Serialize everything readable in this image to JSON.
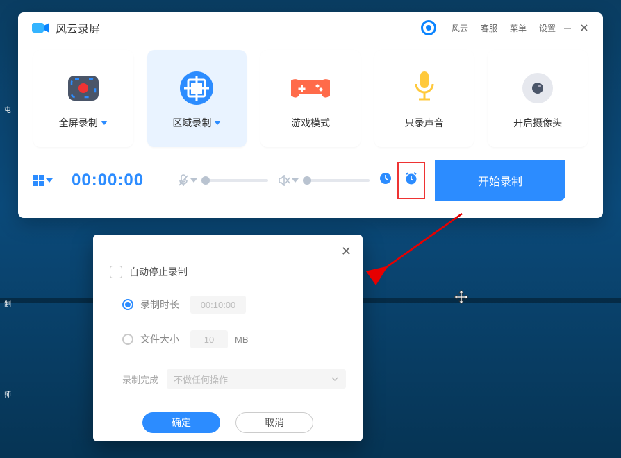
{
  "app": {
    "title": "风云录屏"
  },
  "titlebar": {
    "links": [
      "风云",
      "客服",
      "菜单",
      "设置"
    ]
  },
  "modes": {
    "fullscreen": "全屏录制",
    "region": "区域录制",
    "game": "游戏模式",
    "audio": "只录声音",
    "camera": "开启摄像头"
  },
  "controls": {
    "timer": "00:00:00",
    "start": "开始录制"
  },
  "modal": {
    "autoStop": "自动停止录制",
    "duration": {
      "label": "录制时长",
      "value": "00:10:00"
    },
    "filesize": {
      "label": "文件大小",
      "value": "10",
      "unit": "MB"
    },
    "after": {
      "label": "录制完成",
      "value": "不做任何操作"
    },
    "ok": "确定",
    "cancel": "取消"
  },
  "desktop": {
    "label1": "屯",
    "label2": "制",
    "label3": "师"
  }
}
